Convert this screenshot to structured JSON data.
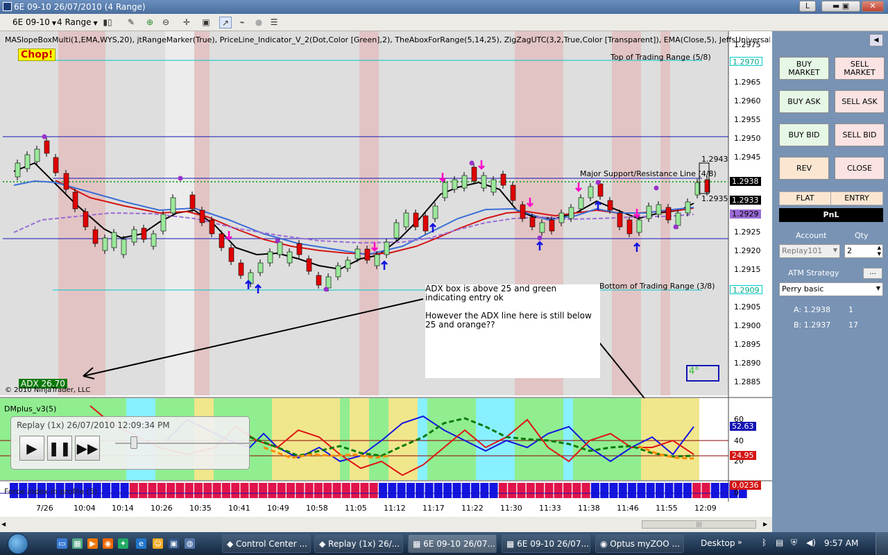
{
  "window": {
    "title": "6E 09-10  26/07/2010 (4 Range)",
    "btn_min": "L",
    "btn_restore": "□",
    "btn_close": "✕"
  },
  "toolbar": {
    "instrument": "6E 09-10",
    "period": "4 Range"
  },
  "chart": {
    "indicators": "MASlopeBoxMulti(1,EMA,WYS,20), jtRangeMarker(True), PriceLine_Indicator_V_2(Dot,Color [Green],2), TheAboxForRange(5,14,25), ZigZagUTC(3,2,True,Color [Transparent]), EMA(Close,5), JeffsUniversalMovingAvera",
    "chop": "Chop!",
    "top_range": "Top of Trading Range (5/8)",
    "bottom_range": "Bottom of Trading Range (3/8)",
    "major_sr": "Major Support/Resistance Line (4/8)",
    "annotation_1": "ADX box is above 25 and green indicating entry ok",
    "annotation_2": "However the ADX line here is still below 25 and orange??",
    "adx": "ADX 26.70",
    "copyright": "© 2010 NinjaTrader, LLC",
    "box4": "4°",
    "dmplus": "DMplus_v3(5)",
    "force_index": "Force index in profile (5)",
    "bar_high": "1.2943",
    "bar_low": "1.2935",
    "price_axis": [
      "1.2975",
      "1.2965",
      "1.2960",
      "1.2955",
      "1.2950",
      "1.2945",
      "1.2925",
      "1.2920",
      "1.2915",
      "1.2905",
      "1.2900",
      "1.2895",
      "1.2890",
      "1.2885"
    ],
    "price_tags": {
      "top": "1.2970",
      "last": "1.2938",
      "a": "1.2933",
      "b": "1.2929",
      "bottom": "1.2909"
    },
    "dm_axis": [
      "60",
      "40",
      "20"
    ],
    "dm_tags": {
      "blue": "52.63",
      "red": "24.95"
    },
    "fi_tag": "0.0236",
    "fi_axis": "0",
    "times": [
      "7/26",
      "10:04",
      "10:14",
      "10:26",
      "10:35",
      "10:41",
      "10:49",
      "10:58",
      "11:05",
      "11:12",
      "11:17",
      "11:22",
      "11:30",
      "11:33",
      "11:38",
      "11:46",
      "11:55",
      "12:09"
    ]
  },
  "replay": {
    "title": "Replay (1x) 26/07/2010 12:09:34 PM",
    "position": 0.14
  },
  "order_panel": {
    "buy_market": "BUY MARKET",
    "sell_market": "SELL MARKET",
    "buy_ask": "BUY ASK",
    "sell_ask": "SELL ASK",
    "buy_bid": "BUY BID",
    "sell_bid": "SELL BID",
    "rev": "REV",
    "close": "CLOSE",
    "flat": "FLAT",
    "entry": "ENTRY",
    "pnl": "PnL",
    "account_label": "Account",
    "qty_label": "Qty",
    "account": "Replay101",
    "qty": "2",
    "atm_label": "ATM Strategy",
    "atm_btn": "...",
    "atm_value": "Perry basic",
    "ask_label": "A: 1.2938",
    "ask_size": "1",
    "bid_label": "B: 1.2937",
    "bid_size": "17"
  },
  "taskbar": {
    "items": [
      "Control Center ...",
      "Replay (1x) 26/...",
      "6E 09-10  26/07...",
      "6E 09-10  26/07...",
      "Optus myZOO ..."
    ],
    "desktop": "Desktop",
    "time": "9:57 AM"
  }
}
